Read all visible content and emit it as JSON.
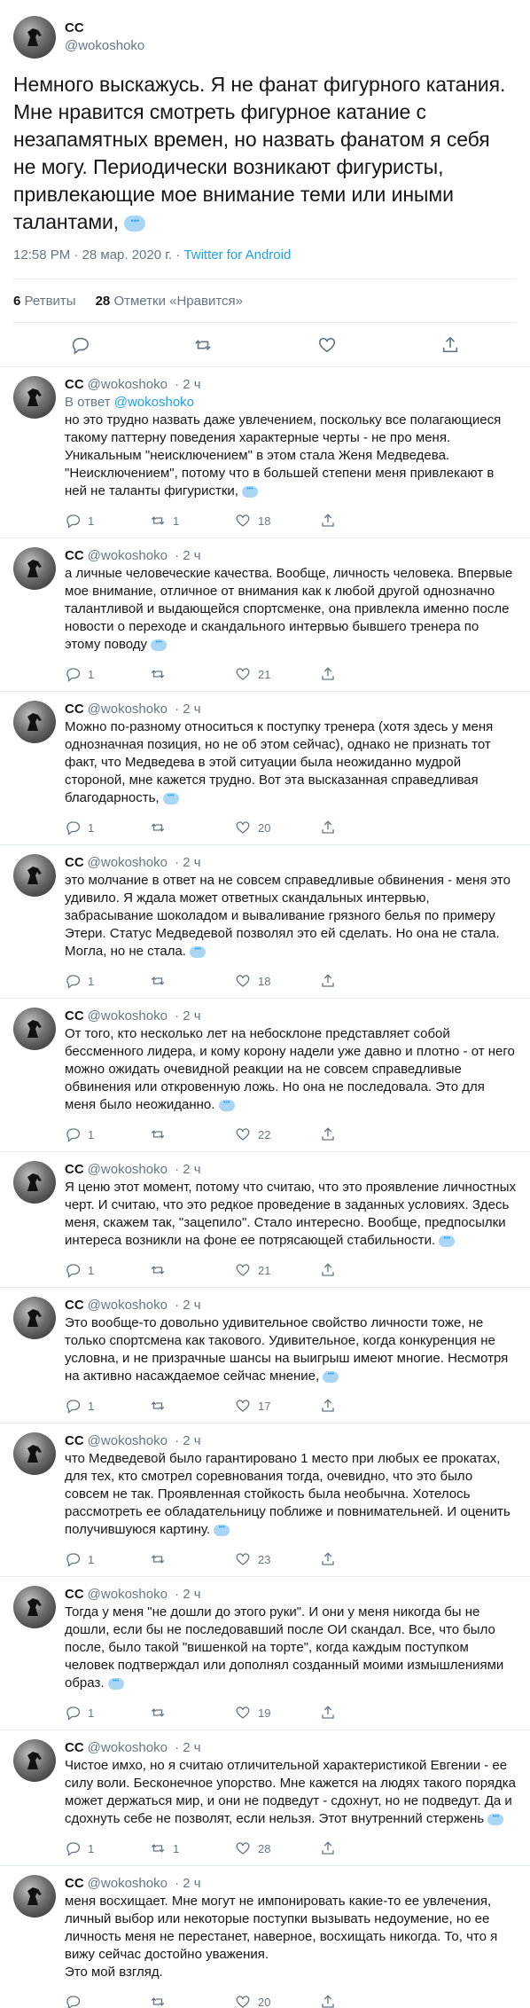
{
  "main": {
    "display_name": "CC",
    "handle": "@wokoshoko",
    "text": "Немного выскажусь. Я не фанат фигурного катания. Мне нравится смотреть фигурное катание с незапамятных времен, но назвать фанатом я себя не могу. Периодически возникают фигуристы, привлекающие мое внимание теми или иными талантами,",
    "time": "12:58 PM · 28 мар. 2020 г. · ",
    "source": "Twitter for Android",
    "retweets_count": "6",
    "retweets_label": "Ретвиты",
    "likes_count": "28",
    "likes_label": "Отметки «Нравится»"
  },
  "replies": [
    {
      "name": "CC",
      "handle": "@wokoshoko",
      "time": "· 2 ч",
      "reply_to_prefix": "В ответ ",
      "reply_to_handle": "@wokoshoko",
      "text": "но это трудно назвать даже увлечением, поскольку все полагающиеся такому паттерну поведения характерные черты - не про меня. Уникальным \"неисключением\" в этом стала Женя Медведева. \"Неисключением\", потому что в большей степени меня привлекают в ней не таланты фигуристки,",
      "replies": "1",
      "retweets": "1",
      "likes": "18"
    },
    {
      "name": "CC",
      "handle": "@wokoshoko",
      "time": "· 2 ч",
      "text": "а личные человеческие качества. Вообще, личность человека. Впервые мое внимание, отличное от внимания как к любой другой однозначно талантливой и выдающейся спортсменке, она привлекла именно после новости о переходе и скандального интервью бывшего тренера по этому поводу",
      "replies": "1",
      "retweets": "",
      "likes": "21"
    },
    {
      "name": "CC",
      "handle": "@wokoshoko",
      "time": "· 2 ч",
      "text": "Можно по-разному относиться к поступку тренера (хотя здесь у меня однозначная позиция, но не об этом сейчас), однако не признать тот факт, что Медведева в этой ситуации была неожиданно мудрой стороной, мне кажется трудно. Вот эта высказанная  справедливая благодарность,",
      "replies": "1",
      "retweets": "",
      "likes": "20"
    },
    {
      "name": "CC",
      "handle": "@wokoshoko",
      "time": "· 2 ч",
      "text": "это молчание в ответ на не совсем справедливые обвинения - меня это удивило. Я ждала может ответных скандальных интервью, забрасывание шоколадом и вываливание грязного белья по примеру Этери. Статус Медведевой позволял это ей сделать. Но она не стала. Могла, но не стала.",
      "replies": "1",
      "retweets": "",
      "likes": "18"
    },
    {
      "name": "CC",
      "handle": "@wokoshoko",
      "time": "· 2 ч",
      "text": "От того, кто несколько лет на небосклоне представляет собой бессменного лидера, и кому корону надели уже давно и плотно - от него можно ожидать очевидной реакции на не совсем справедливые обвинения или откровенную ложь. Но она не последовала. Это для меня  было неожиданно.",
      "replies": "1",
      "retweets": "",
      "likes": "22"
    },
    {
      "name": "CC",
      "handle": "@wokoshoko",
      "time": "· 2 ч",
      "text": "Я ценю этот момент, потому что считаю, что это проявление личностных черт. И считаю, что это редкое проведение в заданных условиях. Здесь меня, скажем так, \"зацепило\". Стало интересно. Вообще, предпосылки интереса возникли на фоне ее потрясающей стабильности.",
      "replies": "1",
      "retweets": "",
      "likes": "21"
    },
    {
      "name": "CC",
      "handle": "@wokoshoko",
      "time": "· 2 ч",
      "text": "Это вообще-то довольно удивительное свойство личности тоже, не только спортсмена как такового. Удивительное, когда конкуренция не условна, и не призрачные шансы на выигрыш имеют многие. Несмотря на активно насаждаемое сейчас мнение,",
      "replies": "1",
      "retweets": "",
      "likes": "17"
    },
    {
      "name": "CC",
      "handle": "@wokoshoko",
      "time": "· 2 ч",
      "text": "что Медведевой было гарантировано 1 место при любых ее прокатах, для тех, кто смотрел соревнования тогда, очевидно, что это было совсем не так. Проявленная стойкость была необычна. Хотелось рассмотреть ее обладательницу поближе и повнимательней. И оценить получившуюся картину.",
      "replies": "1",
      "retweets": "",
      "likes": "23"
    },
    {
      "name": "CC",
      "handle": "@wokoshoko",
      "time": "· 2 ч",
      "text": "Тогда у меня \"не дошли до этого руки\". И они у меня никогда бы не дошли, если бы не последовавший после ОИ скандал. Все, что было после, было такой \"вишенкой на торте\", когда каждым поступком человек подтверждал или дополнял созданный моими измышлениями образ.",
      "replies": "1",
      "retweets": "",
      "likes": "19"
    },
    {
      "name": "CC",
      "handle": "@wokoshoko",
      "time": "· 2 ч",
      "text": "Чистое имхо, но я считаю отличительной характеристикой Евгении - ее силу воли. Бесконечное упорство. Мне кажется на людях такого порядка может держаться мир, и они не подведут - сдохнут, но не подведут. Да и сдохнуть себе не позволят, если нельзя. Этот внутренний стержень",
      "replies": "1",
      "retweets": "1",
      "likes": "28"
    },
    {
      "name": "CC",
      "handle": "@wokoshoko",
      "time": "· 2 ч",
      "text": "меня восхищает. Мне могут не импонировать какие-то ее увлечения, личный выбор или некоторые поступки вызывать недоумение, но ее личность меня не перестанет, наверное, восхищать никогда. То, что я вижу сейчас достойно уважения.\nЭто мой взгляд.",
      "replies": "",
      "retweets": "",
      "likes": "20",
      "no_dots": true
    }
  ],
  "icons": {
    "reply": "reply-icon",
    "retweet": "retweet-icon",
    "like": "like-icon",
    "share": "share-icon"
  },
  "colors": {
    "link": "#1da1f2",
    "muted": "#657786",
    "border": "#e6ecf0"
  }
}
